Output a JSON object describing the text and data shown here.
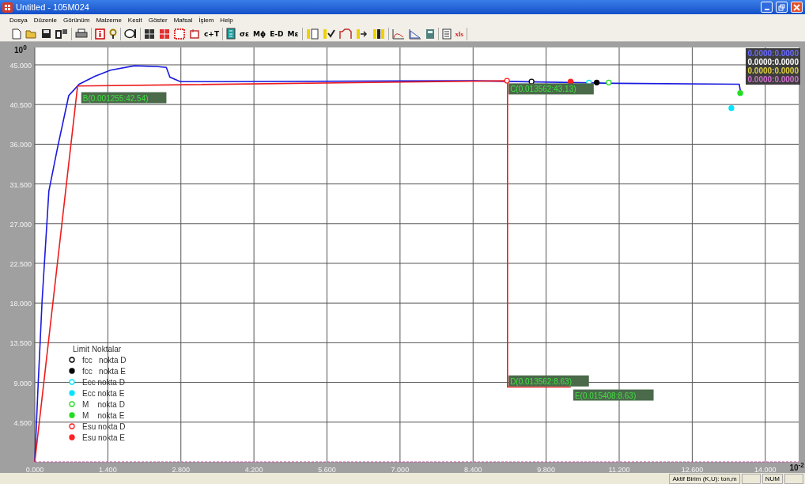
{
  "window": {
    "title": "Untitled - 105M024"
  },
  "menu": [
    "Dosya",
    "Düzenle",
    "Görünüm",
    "Malzeme",
    "Kesit",
    "Göster",
    "Mafsal",
    "İşlem",
    "Help"
  ],
  "toolbar_texts": [
    "c+T",
    "σε",
    "Mϕ",
    "E-D",
    "Mε",
    "xls"
  ],
  "chart": {
    "y_unit": "10$^{0}$",
    "x_unit": "10$^{-2}$",
    "readouts": [
      {
        "text": "0.0000:0.0000",
        "color": "#6a6aff"
      },
      {
        "text": "0.0000:0.0000",
        "color": "#ffffff"
      },
      {
        "text": "0.0000:0.0000",
        "color": "#e0d040"
      },
      {
        "text": "0.0000:0.0000",
        "color": "#d070d0"
      }
    ],
    "chart_data": {
      "type": "line",
      "grid": true,
      "legend": {
        "title": "Limit Noktalar"
      },
      "xlim": [
        0,
        14.64
      ],
      "ylim": [
        0,
        46.97
      ],
      "xticks": [
        {
          "value": 0,
          "label": "0.000"
        },
        {
          "value": 1.4,
          "label": "1.400"
        },
        {
          "value": 2.8,
          "label": "2.800"
        },
        {
          "value": 4.2,
          "label": "4.200"
        },
        {
          "value": 5.6,
          "label": "5.600"
        },
        {
          "value": 7,
          "label": "7.000"
        },
        {
          "value": 8.4,
          "label": "8.400"
        },
        {
          "value": 9.8,
          "label": "9.800"
        },
        {
          "value": 11.2,
          "label": "11.200"
        },
        {
          "value": 12.6,
          "label": "12.600"
        },
        {
          "value": 14,
          "label": "14.000"
        }
      ],
      "yticks": [
        {
          "value": 4.5,
          "label": "4.500"
        },
        {
          "value": 9,
          "label": "9.000"
        },
        {
          "value": 13.5,
          "label": "13.500"
        },
        {
          "value": 18,
          "label": "18.000"
        },
        {
          "value": 22.5,
          "label": "22.500"
        },
        {
          "value": 27,
          "label": "27.000"
        },
        {
          "value": 31.5,
          "label": "31.500"
        },
        {
          "value": 36,
          "label": "36.000"
        },
        {
          "value": 40.5,
          "label": "40.500"
        },
        {
          "value": 45,
          "label": "45.000"
        }
      ],
      "series": [
        {
          "color": "#1a1ae0",
          "x": [
            0,
            0.06,
            0.14,
            0.27,
            0.44,
            0.65,
            0.85,
            1.15,
            1.45,
            1.91,
            2.36,
            2.52,
            2.59,
            2.79,
            3.58,
            8.42,
            11.15,
            13.5,
            13.53
          ],
          "values": [
            0,
            8.3,
            18.2,
            30.7,
            35.7,
            41.5,
            42.8,
            43.7,
            44.4,
            44.9,
            44.8,
            44.7,
            43.6,
            43.1,
            43.1,
            43.2,
            42.9,
            42.8,
            41.8
          ]
        },
        {
          "color": "#ee1c1c",
          "x": [
            0,
            0.82,
            9.06,
            9.06,
            10.27
          ],
          "values": [
            0,
            42.6,
            43.2,
            8.5,
            8.5
          ]
        },
        {
          "marker": "hollow-circle",
          "name": "fcc   nokta D",
          "color": "#000000",
          "x": [
            9.52
          ],
          "values": [
            43.1
          ]
        },
        {
          "marker": "circle",
          "name": "fcc   nokta E",
          "color": "#000000",
          "x": [
            10.77
          ],
          "values": [
            43.0
          ]
        },
        {
          "marker": "hollow-circle",
          "name": "Ecc nokta D",
          "color": "#00e5ff",
          "x": [
            10.62
          ],
          "values": [
            43.0
          ]
        },
        {
          "marker": "circle",
          "name": "Ecc nokta E",
          "color": "#00e5ff",
          "x": [
            13.35
          ],
          "values": [
            40.1
          ]
        },
        {
          "marker": "hollow-circle",
          "name": "M    nokta D",
          "color": "#22dd22",
          "x": [
            11.0
          ],
          "values": [
            43.0
          ]
        },
        {
          "marker": "circle",
          "name": "M    nokta E",
          "color": "#22dd22",
          "x": [
            13.52
          ],
          "values": [
            41.8
          ]
        },
        {
          "marker": "hollow-circle",
          "name": "Esu nokta D",
          "color": "#ff2020",
          "x": [
            9.05
          ],
          "values": [
            43.2
          ]
        },
        {
          "marker": "circle",
          "name": "Esu nokta E",
          "color": "#ff2020",
          "x": [
            10.27
          ],
          "values": [
            43.1
          ]
        }
      ],
      "annotations": [
        {
          "text": "B(0.001255:42.54)",
          "x": 0.89,
          "y": 41.9
        },
        {
          "text": "C(0.013562:43.13)",
          "x": 9.08,
          "y": 42.9
        },
        {
          "text": "D(0.013562:8.63)",
          "x": 9.08,
          "y": 9.8
        },
        {
          "text": "E(0.015408:8.63)",
          "x": 10.32,
          "y": 8.2
        }
      ]
    }
  },
  "status_bar": [
    "Aktif Birim (K,U): ton,m",
    "NUM"
  ]
}
